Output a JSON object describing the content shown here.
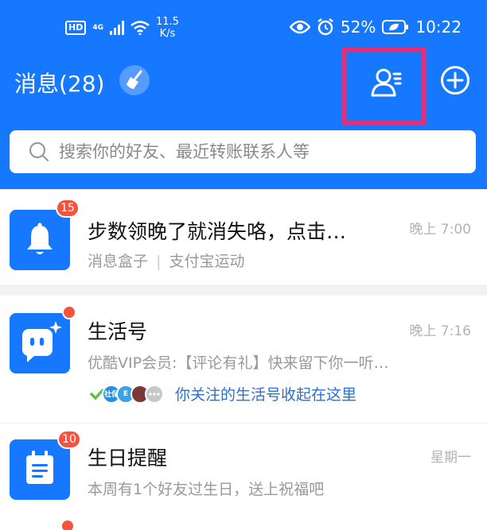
{
  "status": {
    "hd": "HD",
    "network": "4G",
    "speed_value": "11.5",
    "speed_unit": "K/s",
    "battery": "52%",
    "time": "10:22"
  },
  "header": {
    "title": "消息(28)"
  },
  "search": {
    "placeholder": "搜索你的好友、最近转账联系人等"
  },
  "messages": [
    {
      "name": "步数领晚了就消失咯，点击…",
      "sub_source": "消息盒子",
      "sub_app": "支付宝运动",
      "time": "晚上 7:00",
      "badge": "15"
    },
    {
      "name": "生活号",
      "sub": "优酷VIP会员:【评论有礼】快来留下你一听…",
      "time": "晚上 7:16",
      "follow_text": "你关注的生活号收起在这里",
      "mini_avatars": [
        "社保",
        "E"
      ]
    },
    {
      "name": "生日提醒",
      "sub": "本周有1个好友过生日，送上祝福吧",
      "time": "星期一",
      "badge": "10"
    }
  ],
  "colors": {
    "brand": "#1677ff",
    "badge": "#f5533d",
    "highlight": "#e0307a",
    "link": "#2a6fd6"
  }
}
